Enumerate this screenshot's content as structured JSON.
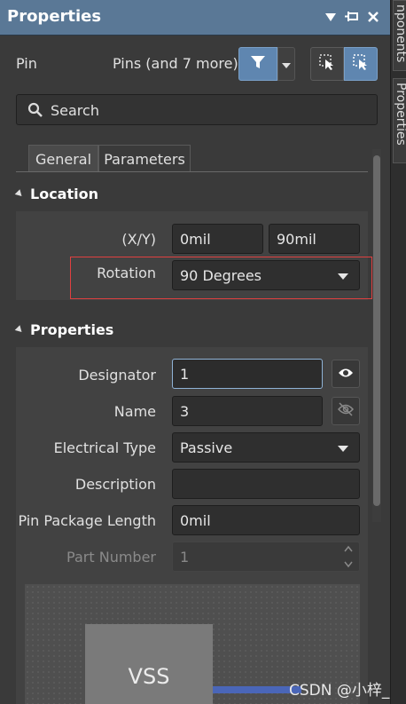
{
  "title": "Properties",
  "side_tabs": [
    "nponents",
    "Properties"
  ],
  "header": {
    "object_type": "Pin",
    "selection_summary": "Pins (and 7 more)"
  },
  "search": {
    "placeholder": "Search"
  },
  "tabs": [
    {
      "label": "General",
      "active": true
    },
    {
      "label": "Parameters",
      "active": false
    }
  ],
  "location": {
    "header": "Location",
    "xy_label": "(X/Y)",
    "x_value": "0mil",
    "y_value": "90mil",
    "rotation_label": "Rotation",
    "rotation_value": "90 Degrees"
  },
  "properties": {
    "header": "Properties",
    "designator_label": "Designator",
    "designator_value": "1",
    "name_label": "Name",
    "name_value": "3",
    "electrical_type_label": "Electrical Type",
    "electrical_type_value": "Passive",
    "description_label": "Description",
    "description_value": "",
    "pin_package_length_label": "Pin Package Length",
    "pin_package_length_value": "0mil",
    "part_number_label": "Part Number",
    "part_number_value": "1"
  },
  "preview": {
    "component_label": "VSS"
  },
  "watermark": "CSDN @小梓_",
  "colors": {
    "titlebar": "#5a7896",
    "accent_button": "#5f86b0",
    "highlight_border": "#e04040",
    "pin_line": "#4a66b8"
  }
}
